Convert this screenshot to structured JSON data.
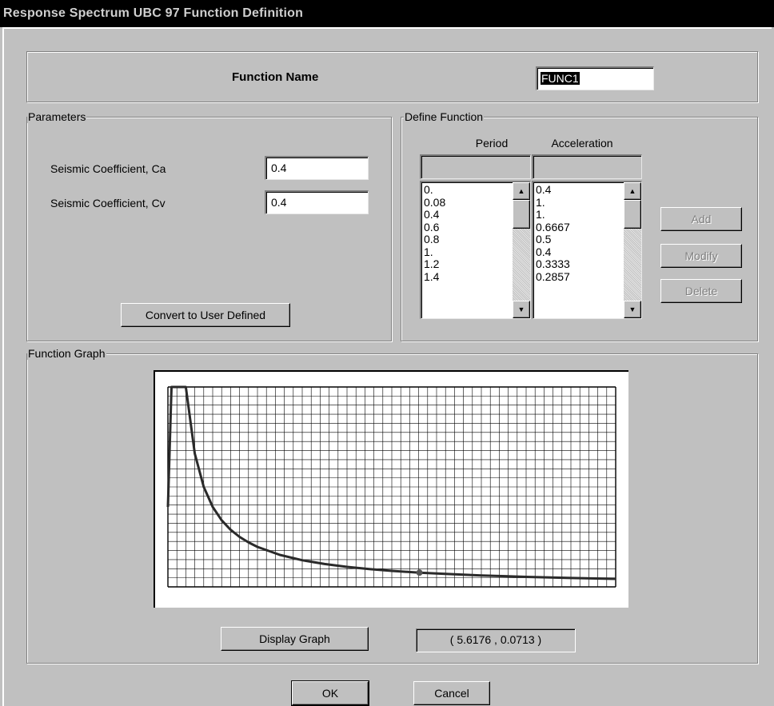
{
  "window": {
    "title": "Response Spectrum UBC 97 Function Definition"
  },
  "function_name": {
    "label": "Function Name",
    "value": "FUNC1"
  },
  "parameters": {
    "group_label": "Parameters",
    "ca_label": "Seismic Coefficient, Ca",
    "ca_value": "0.4",
    "cv_label": "Seismic Coefficient, Cv",
    "cv_value": "0.4",
    "convert_button": "Convert to User Defined"
  },
  "define_function": {
    "group_label": "Define Function",
    "period_header": "Period",
    "acceleration_header": "Acceleration",
    "period_input": "",
    "acceleration_input": "",
    "periods": [
      "0.",
      "0.08",
      "0.4",
      "0.6",
      "0.8",
      "1.",
      "1.2",
      "1.4"
    ],
    "accelerations": [
      "0.4",
      "1.",
      "1.",
      "0.6667",
      "0.5",
      "0.4",
      "0.3333",
      "0.2857"
    ],
    "add_button": "Add",
    "modify_button": "Modify",
    "delete_button": "Delete"
  },
  "function_graph": {
    "group_label": "Function Graph",
    "display_button": "Display Graph",
    "cursor_readout": "( 5.6176  ,  0.0713 )"
  },
  "dialog": {
    "ok_button": "OK",
    "cancel_button": "Cancel"
  },
  "chart_data": {
    "type": "line",
    "x": [
      0,
      0.08,
      0.4,
      0.6,
      0.8,
      1.0,
      1.2,
      1.4,
      1.6,
      1.8,
      2.0,
      2.5,
      3.0,
      3.5,
      4.0,
      4.5,
      5.0,
      5.6176,
      6.0,
      7.0,
      8.0,
      9.0,
      10.0
    ],
    "y": [
      0.4,
      1.0,
      1.0,
      0.6667,
      0.5,
      0.4,
      0.3333,
      0.2857,
      0.25,
      0.2222,
      0.2,
      0.16,
      0.1333,
      0.1143,
      0.1,
      0.0889,
      0.08,
      0.0713,
      0.0667,
      0.0571,
      0.05,
      0.0444,
      0.04
    ],
    "cursor_point": [
      5.6176,
      0.0713
    ],
    "xlim": [
      0,
      10
    ],
    "ylim": [
      0,
      1.0
    ],
    "grid": true,
    "line_color": "#2a2a2a",
    "grid_color": "#000000"
  }
}
